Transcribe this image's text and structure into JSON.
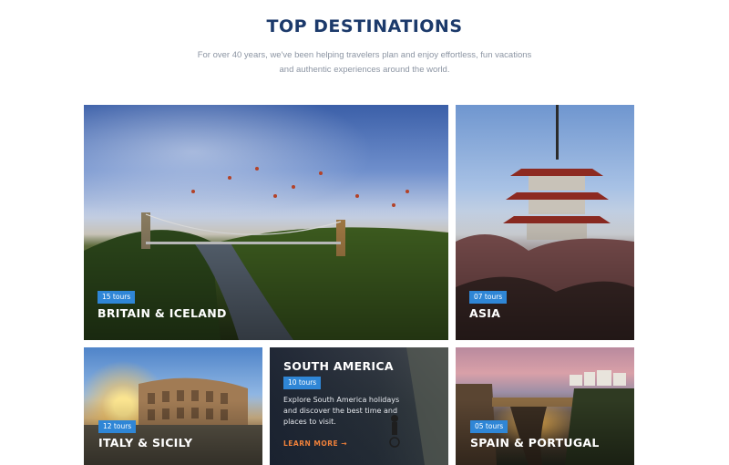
{
  "header": {
    "title": "TOP DESTINATIONS",
    "subtitle_lines": [
      "For over 40 years, we've been helping travelers plan and enjoy effortless, fun vacations",
      "and authentic experiences around the world."
    ]
  },
  "destinations": [
    {
      "name": "BRITAIN & ICELAND",
      "tours": "15 tours"
    },
    {
      "name": "ASIA",
      "tours": "07 tours"
    },
    {
      "name": "ITALY & SICILY",
      "tours": "12 tours"
    },
    {
      "name": "SOUTH AMERICA",
      "tours": "10 tours",
      "description_lines": [
        "Explore South America holidays",
        "and discover the best time and",
        "places to visit."
      ],
      "link": "LEARN MORE →"
    },
    {
      "name": "SPAIN & PORTUGAL",
      "tours": "05 tours"
    }
  ],
  "colors": {
    "title": "#1c3a6b",
    "badge": "#2f86d6",
    "link": "#f0813a"
  }
}
